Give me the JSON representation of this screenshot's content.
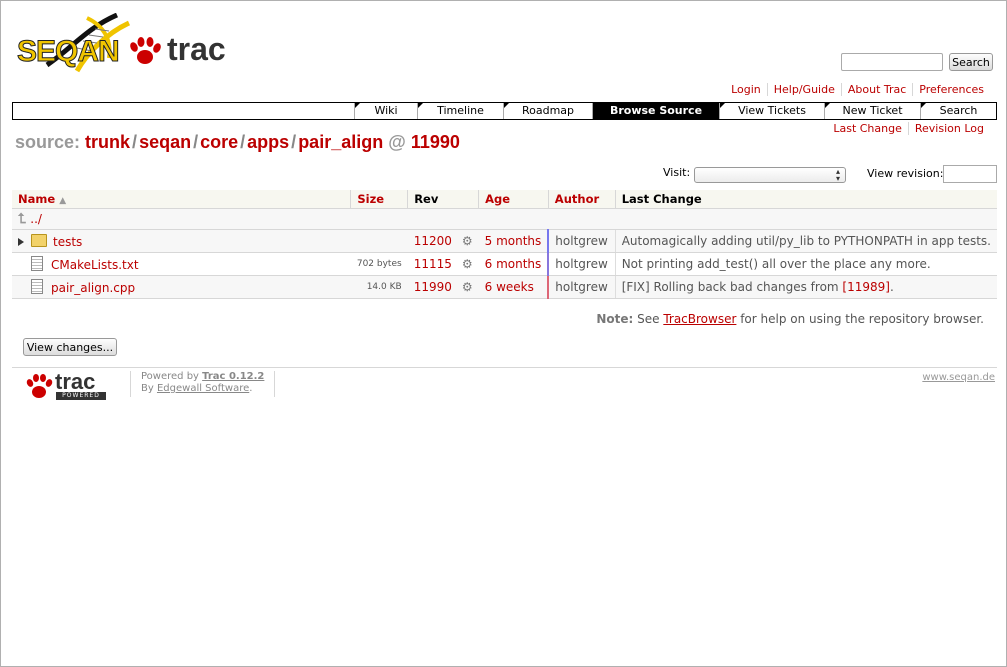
{
  "header": {
    "logo_seqan": "SEQAN",
    "logo_trac": "trac",
    "search_button": "Search"
  },
  "metanav": [
    "Login",
    "Help/Guide",
    "About Trac",
    "Preferences"
  ],
  "mainnav": [
    {
      "label": "Wiki",
      "active": false
    },
    {
      "label": "Timeline",
      "active": false
    },
    {
      "label": "Roadmap",
      "active": false
    },
    {
      "label": "Browse Source",
      "active": true
    },
    {
      "label": "View Tickets",
      "active": false
    },
    {
      "label": "New Ticket",
      "active": false
    },
    {
      "label": "Search",
      "active": false
    }
  ],
  "ctxtnav": [
    "Last Change",
    "Revision Log"
  ],
  "path": {
    "prefix": "source:",
    "segments": [
      "trunk",
      "seqan",
      "core",
      "apps",
      "pair_align"
    ],
    "at": "@",
    "rev": "11990"
  },
  "visit_label": "Visit:",
  "view_revision_label": "View revision:",
  "table": {
    "headers": {
      "name": "Name",
      "sort_indicator": "▲",
      "size": "Size",
      "rev": "Rev",
      "age": "Age",
      "author": "Author",
      "change": "Last Change"
    },
    "parent": "../",
    "rows": [
      {
        "name": "tests",
        "size": "",
        "rev": "11200",
        "age": "5 months",
        "author": "holtgrew",
        "change": "Automagically adding util/py_lib to PYTHONPATH in app tests."
      },
      {
        "name": "CMakeLists.txt",
        "size": "702 bytes",
        "rev": "11115",
        "age": "6 months",
        "author": "holtgrew",
        "change": "Not printing add_test() all over the place any more."
      },
      {
        "name": "pair_align.cpp",
        "size": "14.0 KB",
        "rev": "11990",
        "age": "6 weeks",
        "author": "holtgrew",
        "change_pre": "[FIX] Rolling back bad changes from ",
        "change_link": "[11989]",
        "change_post": "."
      }
    ]
  },
  "note": {
    "label": "Note:",
    "pre": " See ",
    "link": "TracBrowser",
    "post": " for help on using the repository browser."
  },
  "view_changes_button": "View changes...",
  "footer": {
    "logo_text": "trac",
    "logo_sub": "POWERED",
    "powered_by": "Powered by ",
    "trac_version": "Trac 0.12.2",
    "by": "By ",
    "edgewall": "Edgewall Software",
    "dot": ".",
    "site": "www.seqan.de"
  },
  "colors": {
    "link": "#bb0000",
    "active_tab": "#000000",
    "header_bg": "#f7f7f0",
    "age_bar_blue": "#7777ee",
    "age_bar_red": "#dd6677"
  }
}
